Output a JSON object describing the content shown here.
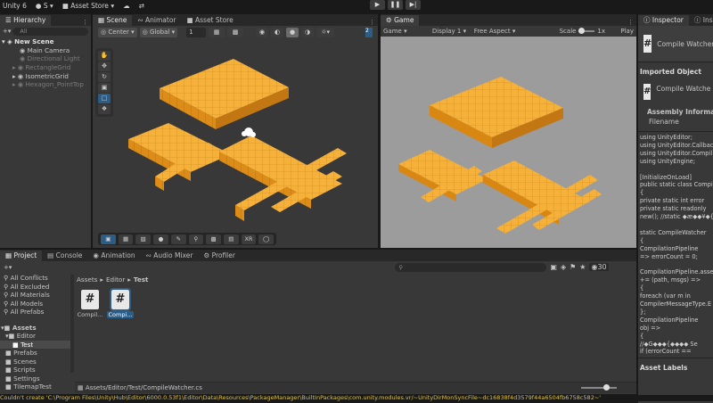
{
  "menubar": {
    "app": "Unity 6",
    "account": "S",
    "asset_store": "Asset Store"
  },
  "tabs": {
    "hierarchy": "Hierarchy",
    "scene": "Scene",
    "animator": "Animator",
    "asset_store": "Asset Store",
    "game": "Game",
    "inspector": "Inspector",
    "inspector2": "Insp"
  },
  "hierarchy": {
    "search_placeholder": "All",
    "scene_name": "New Scene",
    "items": [
      "Main Camera",
      "Directional Light",
      "RectangleGrid",
      "IsometricGrid",
      "Hexagon_PointTop"
    ]
  },
  "scene_toolbar": {
    "pivot": "Center",
    "space": "Global",
    "grid_value": "1"
  },
  "scene_bottom": {
    "label_xr": "XR"
  },
  "game_toolbar": {
    "mode": "Game",
    "display": "Display 1",
    "aspect": "Free Aspect",
    "scale_label": "Scale",
    "scale_value": "1x",
    "play": "Play"
  },
  "inspector": {
    "title": "Compile Watcher",
    "imported_object": "Imported Object",
    "asset_title": "Compile Watche",
    "assembly_info": "Assembly Informatio",
    "filename": "Filename",
    "code_lines": [
      "using UnityEditor;",
      "using UnityEditor.Callbac",
      "using UnityEditor.Compil",
      "using UnityEngine;",
      "",
      "[InitializeOnLoad]",
      "public static class Compi",
      "{",
      "    private static int error",
      "    private static readonly",
      "new(); //static ◆æ◆◆¥◆{◆",
      "",
      "    static CompileWatcher",
      "    {",
      "        CompilationPipeline",
      "=> errorCount = 0;",
      "",
      "CompilationPipeline.assem",
      "+= (path, msgs) =>",
      "        {",
      "            foreach (var m in",
      "CompilerMessageType.E",
      "        };",
      "        CompilationPipeline",
      "obj =>",
      "        {",
      "            //◆G◆◆◆{◆◆◆◆ Se",
      "            if (errorCount =="
    ],
    "asset_labels": "Asset Labels"
  },
  "bottom_tabs": {
    "project": "Project",
    "console": "Console",
    "animation": "Animation",
    "audio_mixer": "Audio Mixer",
    "profiler": "Profiler"
  },
  "favorites": [
    "All Conflicts",
    "All Excluded",
    "All Materials",
    "All Models",
    "All Prefabs"
  ],
  "assets": {
    "root": "Assets",
    "items": [
      "Editor",
      "Test",
      "Prefabs",
      "Scenes",
      "Scripts",
      "Settings",
      "TilemapTest"
    ]
  },
  "project": {
    "breadcrumb": [
      "Assets",
      "Editor",
      "Test"
    ],
    "files": [
      "Compil...",
      "Compi..."
    ],
    "count": "30",
    "path": "Assets/Editor/Test/CompileWatcher.cs"
  },
  "status": {
    "message": "Couldn't create 'C:\\Program Files\\Unity\\Hub\\Editor\\6000.0.53f1\\Editor\\Data\\Resources\\PackageManager\\BuiltInPackages\\com.unity.modules.vr/~UnityDirMonSyncFile~dc16838f4d3579f44a6504fb6758c582~'"
  },
  "colors": {
    "accent": "#2c5d87",
    "cube_top": "#f6b13a",
    "cube_side": "#d88712",
    "status_error": "#e0c345"
  }
}
